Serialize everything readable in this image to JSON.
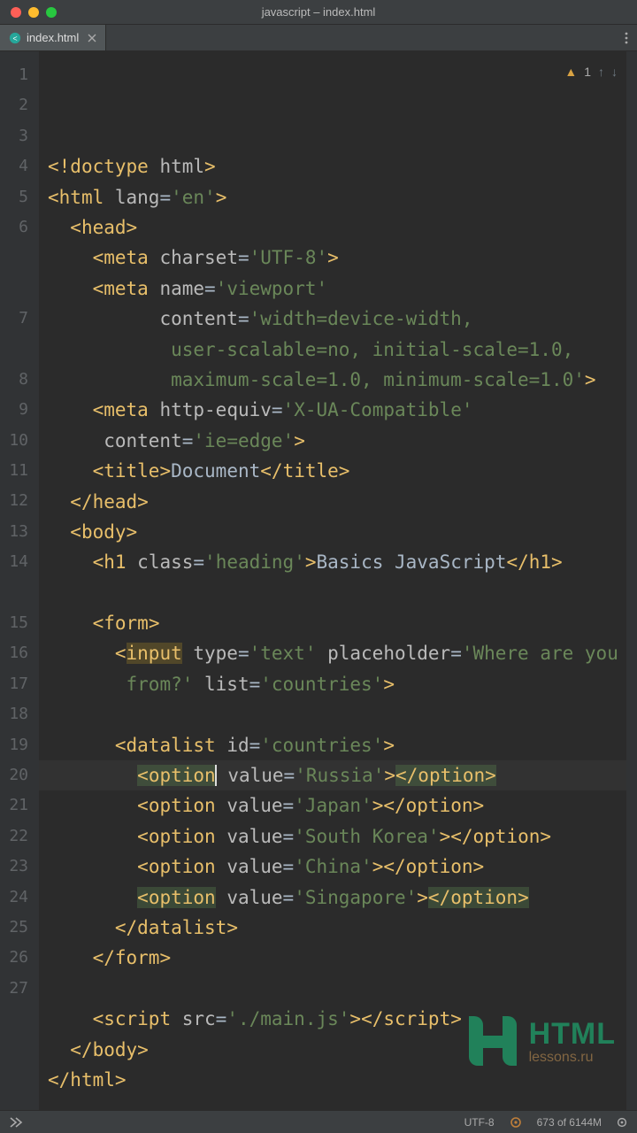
{
  "window": {
    "title": "javascript – index.html"
  },
  "tabs": [
    {
      "label": "index.html"
    }
  ],
  "indicators": {
    "warn_count": "1"
  },
  "status": {
    "encoding": "UTF-8",
    "memory": "673 of 6144M"
  },
  "watermark": {
    "brand": "HTML",
    "domain": "lessons.ru"
  },
  "code_lines": [
    {
      "n": 1,
      "tokens": [
        [
          "brk",
          "<!"
        ],
        [
          "tag",
          "doctype"
        ],
        [
          "attr",
          " html"
        ],
        [
          "brk",
          ">"
        ]
      ]
    },
    {
      "n": 2,
      "tokens": [
        [
          "brk",
          "<"
        ],
        [
          "tag",
          "html"
        ],
        [
          "attr",
          " lang"
        ],
        [
          "eq",
          "="
        ],
        [
          "str",
          "'en'"
        ],
        [
          "brk",
          ">"
        ]
      ]
    },
    {
      "n": 3,
      "tokens": [
        [
          "txt",
          "  "
        ],
        [
          "brk",
          "<"
        ],
        [
          "tag",
          "head"
        ],
        [
          "brk",
          ">"
        ]
      ]
    },
    {
      "n": 4,
      "tokens": [
        [
          "txt",
          "    "
        ],
        [
          "brk",
          "<"
        ],
        [
          "tag",
          "meta"
        ],
        [
          "attr",
          " charset"
        ],
        [
          "eq",
          "="
        ],
        [
          "str",
          "'UTF-8'"
        ],
        [
          "brk",
          ">"
        ]
      ]
    },
    {
      "n": 5,
      "tokens": [
        [
          "txt",
          "    "
        ],
        [
          "brk",
          "<"
        ],
        [
          "tag",
          "meta"
        ],
        [
          "attr",
          " name"
        ],
        [
          "eq",
          "="
        ],
        [
          "str",
          "'viewport'"
        ]
      ]
    },
    {
      "n": 6,
      "tokens": [
        [
          "txt",
          "          "
        ],
        [
          "attr",
          "content"
        ],
        [
          "eq",
          "="
        ],
        [
          "str",
          "'width=device-width,"
        ]
      ]
    },
    {
      "n": 6,
      "soft": true,
      "tokens": [
        [
          "txt",
          "           "
        ],
        [
          "str",
          "user-scalable=no, initial-scale=1.0,"
        ]
      ]
    },
    {
      "n": 6,
      "soft": true,
      "tokens": [
        [
          "txt",
          "           "
        ],
        [
          "str",
          "maximum-scale=1.0, minimum-scale=1.0'"
        ],
        [
          "brk",
          ">"
        ]
      ]
    },
    {
      "n": 7,
      "tokens": [
        [
          "txt",
          "    "
        ],
        [
          "brk",
          "<"
        ],
        [
          "tag",
          "meta"
        ],
        [
          "attr",
          " http-equiv"
        ],
        [
          "eq",
          "="
        ],
        [
          "str",
          "'X-UA-Compatible'"
        ]
      ]
    },
    {
      "n": 7,
      "soft": true,
      "tokens": [
        [
          "txt",
          "     "
        ],
        [
          "attr",
          "content"
        ],
        [
          "eq",
          "="
        ],
        [
          "str",
          "'ie=edge'"
        ],
        [
          "brk",
          ">"
        ]
      ]
    },
    {
      "n": 8,
      "tokens": [
        [
          "txt",
          "    "
        ],
        [
          "brk",
          "<"
        ],
        [
          "tag",
          "title"
        ],
        [
          "brk",
          ">"
        ],
        [
          "txt",
          "Document"
        ],
        [
          "brk",
          "</"
        ],
        [
          "tag",
          "title"
        ],
        [
          "brk",
          ">"
        ]
      ]
    },
    {
      "n": 9,
      "tokens": [
        [
          "txt",
          "  "
        ],
        [
          "brk",
          "</"
        ],
        [
          "tag",
          "head"
        ],
        [
          "brk",
          ">"
        ]
      ]
    },
    {
      "n": 10,
      "tokens": [
        [
          "txt",
          "  "
        ],
        [
          "brk",
          "<"
        ],
        [
          "tag",
          "body"
        ],
        [
          "brk",
          ">"
        ]
      ]
    },
    {
      "n": 11,
      "tokens": [
        [
          "txt",
          "    "
        ],
        [
          "brk",
          "<"
        ],
        [
          "tag",
          "h1"
        ],
        [
          "attr",
          " class"
        ],
        [
          "eq",
          "="
        ],
        [
          "str",
          "'heading'"
        ],
        [
          "brk",
          ">"
        ],
        [
          "txt",
          "Basics JavaScript"
        ],
        [
          "brk",
          "</"
        ],
        [
          "tag",
          "h1"
        ],
        [
          "brk",
          ">"
        ]
      ]
    },
    {
      "n": 12,
      "tokens": []
    },
    {
      "n": 13,
      "tokens": [
        [
          "txt",
          "    "
        ],
        [
          "brk",
          "<"
        ],
        [
          "tag",
          "form"
        ],
        [
          "brk",
          ">"
        ]
      ]
    },
    {
      "n": 14,
      "tokens": [
        [
          "txt",
          "      "
        ],
        [
          "brk",
          "<"
        ],
        [
          "tag word-hi",
          "input"
        ],
        [
          "attr",
          " type"
        ],
        [
          "eq",
          "="
        ],
        [
          "str",
          "'text'"
        ],
        [
          "attr",
          " placeholder"
        ],
        [
          "eq",
          "="
        ],
        [
          "str",
          "'Where are you"
        ]
      ]
    },
    {
      "n": 14,
      "soft": true,
      "tokens": [
        [
          "txt",
          "       "
        ],
        [
          "str",
          "from?'"
        ],
        [
          "attr",
          " list"
        ],
        [
          "eq",
          "="
        ],
        [
          "str",
          "'countries'"
        ],
        [
          "brk",
          ">"
        ]
      ]
    },
    {
      "n": 15,
      "tokens": []
    },
    {
      "n": 16,
      "tokens": [
        [
          "txt",
          "      "
        ],
        [
          "brk",
          "<"
        ],
        [
          "tag",
          "datalist"
        ],
        [
          "attr",
          " id"
        ],
        [
          "eq",
          "="
        ],
        [
          "str",
          "'countries'"
        ],
        [
          "brk",
          ">"
        ]
      ]
    },
    {
      "n": 17,
      "hl": true,
      "tokens": [
        [
          "txt",
          "        "
        ],
        [
          "brk occ",
          "<"
        ],
        [
          "tag occ",
          "option"
        ],
        [
          "attr",
          " value"
        ],
        [
          "eq",
          "="
        ],
        [
          "str",
          "'Russia'"
        ],
        [
          "brk",
          ">"
        ],
        [
          "brk occ",
          "</"
        ],
        [
          "tag occ",
          "option"
        ],
        [
          "brk occ",
          ">"
        ]
      ],
      "caret_before": 3
    },
    {
      "n": 18,
      "tokens": [
        [
          "txt",
          "        "
        ],
        [
          "brk",
          "<"
        ],
        [
          "tag",
          "option"
        ],
        [
          "attr",
          " value"
        ],
        [
          "eq",
          "="
        ],
        [
          "str",
          "'Japan'"
        ],
        [
          "brk",
          ">"
        ],
        [
          "brk",
          "</"
        ],
        [
          "tag",
          "option"
        ],
        [
          "brk",
          ">"
        ]
      ]
    },
    {
      "n": 19,
      "tokens": [
        [
          "txt",
          "        "
        ],
        [
          "brk",
          "<"
        ],
        [
          "tag",
          "option"
        ],
        [
          "attr",
          " value"
        ],
        [
          "eq",
          "="
        ],
        [
          "str",
          "'South Korea'"
        ],
        [
          "brk",
          ">"
        ],
        [
          "brk",
          "</"
        ],
        [
          "tag",
          "option"
        ],
        [
          "brk",
          ">"
        ]
      ]
    },
    {
      "n": 20,
      "tokens": [
        [
          "txt",
          "        "
        ],
        [
          "brk",
          "<"
        ],
        [
          "tag",
          "option"
        ],
        [
          "attr",
          " value"
        ],
        [
          "eq",
          "="
        ],
        [
          "str",
          "'China'"
        ],
        [
          "brk",
          ">"
        ],
        [
          "brk",
          "</"
        ],
        [
          "tag",
          "option"
        ],
        [
          "brk",
          ">"
        ]
      ]
    },
    {
      "n": 21,
      "tokens": [
        [
          "txt",
          "        "
        ],
        [
          "brk occ",
          "<"
        ],
        [
          "tag occ",
          "option"
        ],
        [
          "attr",
          " value"
        ],
        [
          "eq",
          "="
        ],
        [
          "str",
          "'Singapore'"
        ],
        [
          "brk",
          ">"
        ],
        [
          "brk occ",
          "</"
        ],
        [
          "tag occ",
          "option"
        ],
        [
          "brk occ",
          ">"
        ]
      ]
    },
    {
      "n": 22,
      "tokens": [
        [
          "txt",
          "      "
        ],
        [
          "brk",
          "</"
        ],
        [
          "tag",
          "datalist"
        ],
        [
          "brk",
          ">"
        ]
      ]
    },
    {
      "n": 23,
      "tokens": [
        [
          "txt",
          "    "
        ],
        [
          "brk",
          "</"
        ],
        [
          "tag",
          "form"
        ],
        [
          "brk",
          ">"
        ]
      ]
    },
    {
      "n": 24,
      "tokens": []
    },
    {
      "n": 25,
      "tokens": [
        [
          "txt",
          "    "
        ],
        [
          "brk",
          "<"
        ],
        [
          "tag",
          "script"
        ],
        [
          "attr",
          " src"
        ],
        [
          "eq",
          "="
        ],
        [
          "str",
          "'./main.js'"
        ],
        [
          "brk",
          ">"
        ],
        [
          "brk",
          "</"
        ],
        [
          "tag",
          "script"
        ],
        [
          "brk",
          ">"
        ]
      ]
    },
    {
      "n": 26,
      "tokens": [
        [
          "txt",
          "  "
        ],
        [
          "brk",
          "</"
        ],
        [
          "tag",
          "body"
        ],
        [
          "brk",
          ">"
        ]
      ]
    },
    {
      "n": 27,
      "tokens": [
        [
          "brk",
          "</"
        ],
        [
          "tag",
          "html"
        ],
        [
          "brk",
          ">"
        ]
      ]
    }
  ]
}
